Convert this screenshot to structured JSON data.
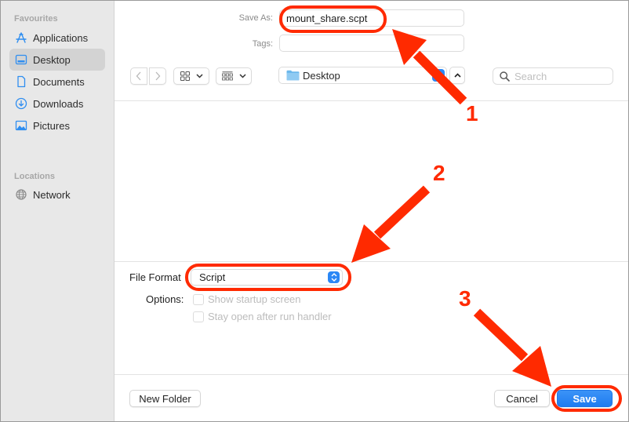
{
  "sidebar": {
    "favourites_heading": "Favourites",
    "locations_heading": "Locations",
    "favourites": [
      {
        "label": "Applications",
        "icon": "applications-icon",
        "selected": false
      },
      {
        "label": "Desktop",
        "icon": "desktop-icon",
        "selected": true
      },
      {
        "label": "Documents",
        "icon": "document-icon",
        "selected": false
      },
      {
        "label": "Downloads",
        "icon": "downloads-icon",
        "selected": false
      },
      {
        "label": "Pictures",
        "icon": "pictures-icon",
        "selected": false
      }
    ],
    "locations": [
      {
        "label": "Network",
        "icon": "network-globe-icon"
      }
    ]
  },
  "save_as": {
    "label": "Save As:",
    "value": "mount_share.scpt"
  },
  "tags": {
    "label": "Tags:",
    "value": ""
  },
  "toolbar": {
    "back_icon": "chevron-left-icon",
    "forward_icon": "chevron-right-icon",
    "icon_view_icon": "grid-view-icon",
    "group_view_icon": "gallery-view-icon",
    "location": "Desktop",
    "expand_icon": "chevron-up-icon",
    "search_placeholder": "Search"
  },
  "file_format": {
    "label": "File Format",
    "value": "Script"
  },
  "options": {
    "label": "Options:",
    "items": [
      {
        "label": "Show startup screen",
        "checked": false,
        "enabled": false
      },
      {
        "label": "Stay open after run handler",
        "checked": false,
        "enabled": false
      }
    ]
  },
  "buttons": {
    "new_folder": "New Folder",
    "cancel": "Cancel",
    "save": "Save"
  },
  "annotations": {
    "color": "#ff2a00",
    "steps": [
      "1",
      "2",
      "3"
    ]
  },
  "colors": {
    "accent": "#2b87f5",
    "sidebar_bg": "#e8e8e8",
    "sidebar_selected": "#d3d3d3",
    "sidebar_icon": "#2f8ef0"
  }
}
